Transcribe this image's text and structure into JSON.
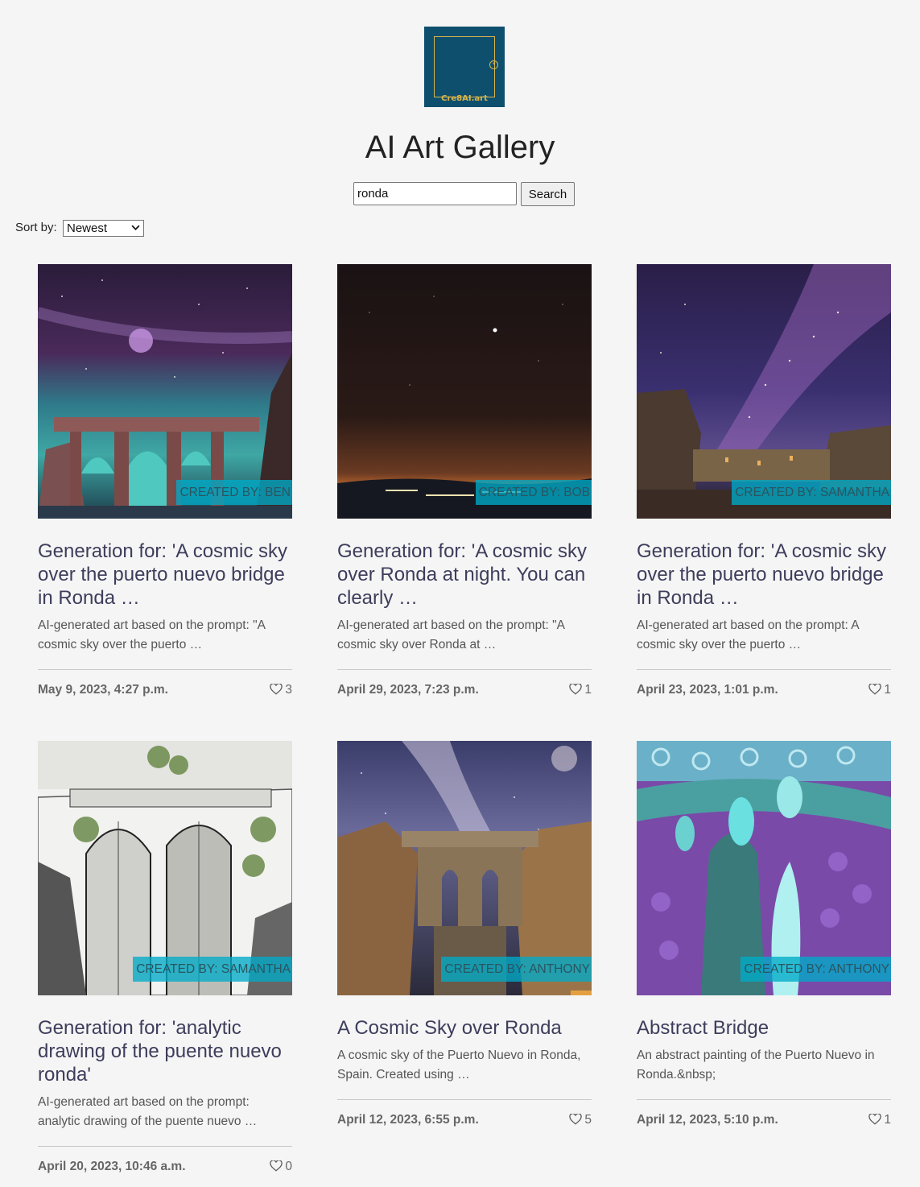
{
  "brand": {
    "logo_text": "Cre8AI.art",
    "logo_bg": "#0e4f6e",
    "logo_accent": "#d9b44a"
  },
  "header": {
    "title": "AI Art Gallery"
  },
  "search": {
    "value": "ronda",
    "button_label": "Search"
  },
  "sort": {
    "label": "Sort by:",
    "selected": "Newest"
  },
  "cards": [
    {
      "creator": "Created by: Ben",
      "title": "Generation for: 'A cosmic sky over the puerto nuevo bridge in Ronda …",
      "description": "AI-generated art based on the prompt: \"A cosmic sky over the puerto …",
      "date": "May 9, 2023, 4:27 p.m.",
      "likes": "3",
      "image": "ronda-bridge-aurora"
    },
    {
      "creator": "Created by: Bob",
      "title": "Generation for: 'A cosmic sky over Ronda at night. You can clearly …",
      "description": "AI-generated art based on the prompt: \"A cosmic sky over Ronda at …",
      "date": "April 29, 2023, 7:23 p.m.",
      "likes": "1",
      "image": "night-sky-city-lights"
    },
    {
      "creator": "Created by: Samantha",
      "title": "Generation for: 'A cosmic sky over the puerto nuevo bridge in Ronda …",
      "description": "AI-generated art based on the prompt: A cosmic sky over the puerto …",
      "date": "April 23, 2023, 1:01 p.m.",
      "likes": "1",
      "image": "milky-way-cliffs"
    },
    {
      "creator": "Created by: Samantha",
      "title": "Generation for: 'analytic drawing of the puente nuevo ronda'",
      "description": "AI-generated art based on the prompt: analytic drawing of the puente nuevo …",
      "date": "April 20, 2023, 10:46 a.m.",
      "likes": "0",
      "image": "bridge-sketch"
    },
    {
      "creator": "Created by: Anthony",
      "title": "A Cosmic Sky over Ronda",
      "description": "A cosmic sky of the Puerto Nuevo in Ronda, Spain. Created using …",
      "date": "April 12, 2023, 6:55 p.m.",
      "likes": "5",
      "image": "bridge-gorge-milky-way"
    },
    {
      "creator": "Created by: Anthony",
      "title": "Abstract Bridge",
      "description": "An abstract painting of the Puerto Nuevo in Ronda.&nbsp;",
      "date": "April 12, 2023, 5:10 p.m.",
      "likes": "1",
      "image": "abstract-bridge"
    }
  ]
}
